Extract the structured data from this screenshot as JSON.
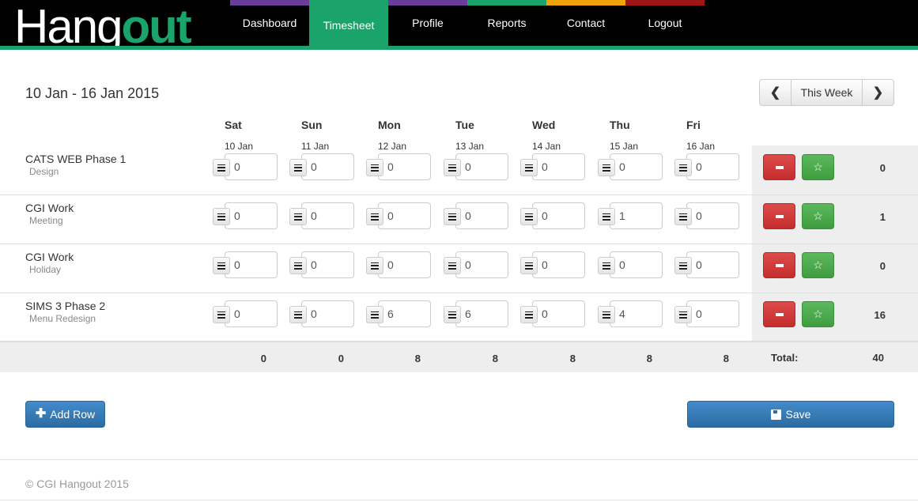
{
  "brand": {
    "part1": "Hang",
    "part2": "out"
  },
  "nav": [
    {
      "label": "Dashboard",
      "color": "#6a3d9a"
    },
    {
      "label": "Timesheet",
      "color": "#1aa36b",
      "active": true
    },
    {
      "label": "Profile",
      "color": "#6a3d9a"
    },
    {
      "label": "Reports",
      "color": "#1aa36b"
    },
    {
      "label": "Contact",
      "color": "#f0a30a"
    },
    {
      "label": "Logout",
      "color": "#a01616"
    }
  ],
  "week": {
    "range": "10 Jan - 16 Jan 2015",
    "prev_icon": "chevron-left-icon",
    "this_week_label": "This Week",
    "next_icon": "chevron-right-icon"
  },
  "days": [
    {
      "name": "Sat",
      "date": "10 Jan"
    },
    {
      "name": "Sun",
      "date": "11 Jan"
    },
    {
      "name": "Mon",
      "date": "12 Jan"
    },
    {
      "name": "Tue",
      "date": "13 Jan"
    },
    {
      "name": "Wed",
      "date": "14 Jan"
    },
    {
      "name": "Thu",
      "date": "15 Jan"
    },
    {
      "name": "Fri",
      "date": "16 Jan"
    }
  ],
  "rows": [
    {
      "project": "CATS WEB Phase 1",
      "task": "Design",
      "hours": [
        "0",
        "0",
        "0",
        "0",
        "0",
        "0",
        "0"
      ],
      "total": "0"
    },
    {
      "project": "CGI Work",
      "task": "Meeting",
      "hours": [
        "0",
        "0",
        "0",
        "0",
        "0",
        "1",
        "0"
      ],
      "total": "1"
    },
    {
      "project": "CGI Work",
      "task": "Holiday",
      "hours": [
        "0",
        "0",
        "0",
        "0",
        "0",
        "0",
        "0"
      ],
      "total": "0"
    },
    {
      "project": "SIMS 3 Phase 2",
      "task": "Menu Redesign",
      "hours": [
        "0",
        "0",
        "6",
        "6",
        "0",
        "4",
        "0"
      ],
      "total": "16"
    }
  ],
  "totals": {
    "days": [
      "0",
      "0",
      "8",
      "8",
      "8",
      "8",
      "8"
    ],
    "label": "Total:",
    "grand": "40"
  },
  "actions": {
    "add_row_label": "Add Row",
    "save_label": "Save"
  },
  "icons": {
    "delete": "minus-icon",
    "favorite": "star-icon",
    "notes": "list-icon"
  },
  "footer": {
    "text": "© CGI Hangout 2015"
  }
}
